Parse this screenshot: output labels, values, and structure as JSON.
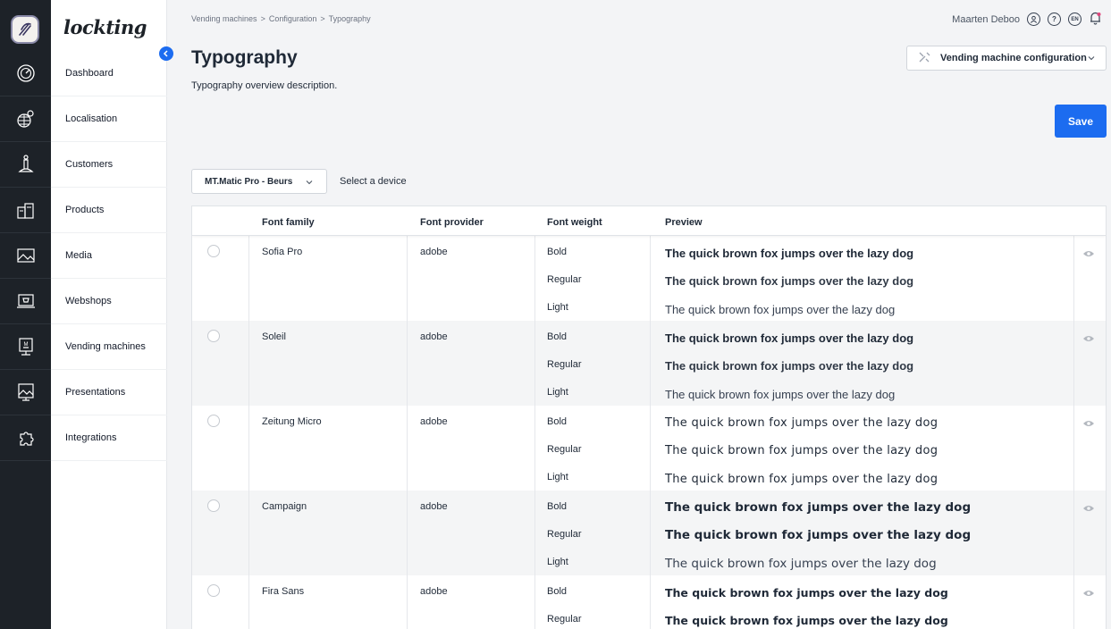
{
  "brand": "lockting",
  "nav": {
    "items": [
      {
        "label": "Dashboard",
        "icon": "dashboard-icon"
      },
      {
        "label": "Localisation",
        "icon": "globe-icon"
      },
      {
        "label": "Customers",
        "icon": "customers-icon"
      },
      {
        "label": "Products",
        "icon": "products-icon"
      },
      {
        "label": "Media",
        "icon": "media-icon"
      },
      {
        "label": "Webshops",
        "icon": "webshop-icon"
      },
      {
        "label": "Vending machines",
        "icon": "vending-machine-icon"
      },
      {
        "label": "Presentations",
        "icon": "presentation-icon"
      },
      {
        "label": "Integrations",
        "icon": "puzzle-icon"
      }
    ]
  },
  "breadcrumb": [
    "Vending machines",
    ">",
    "Configuration",
    ">",
    "Typography"
  ],
  "user": {
    "name": "Maarten Deboo",
    "language": "EN"
  },
  "page": {
    "title": "Typography",
    "description": "Typography overview description.",
    "config_select": "Vending machine configuration",
    "save_label": "Save",
    "device_select": "MT.Matic Pro - Beurs",
    "device_label": "Select a device"
  },
  "table": {
    "headers": [
      "Font family",
      "Font provider",
      "Font weight",
      "Preview"
    ],
    "preview_text": "The quick brown fox jumps over the lazy dog",
    "rows": [
      {
        "family": "Sofia Pro",
        "provider": "adobe",
        "weights": [
          "Bold",
          "Regular",
          "Light"
        ]
      },
      {
        "family": "Soleil",
        "provider": "adobe",
        "weights": [
          "Bold",
          "Regular",
          "Light"
        ]
      },
      {
        "family": "Zeitung Micro",
        "provider": "adobe",
        "weights": [
          "Bold",
          "Regular",
          "Light"
        ]
      },
      {
        "family": "Campaign",
        "provider": "adobe",
        "weights": [
          "Bold",
          "Regular",
          "Light"
        ]
      },
      {
        "family": "Fira Sans",
        "provider": "adobe",
        "weights": [
          "Bold",
          "Regular"
        ]
      }
    ]
  },
  "colors": {
    "accent": "#1c6cf0",
    "rail": "#1d2228"
  }
}
